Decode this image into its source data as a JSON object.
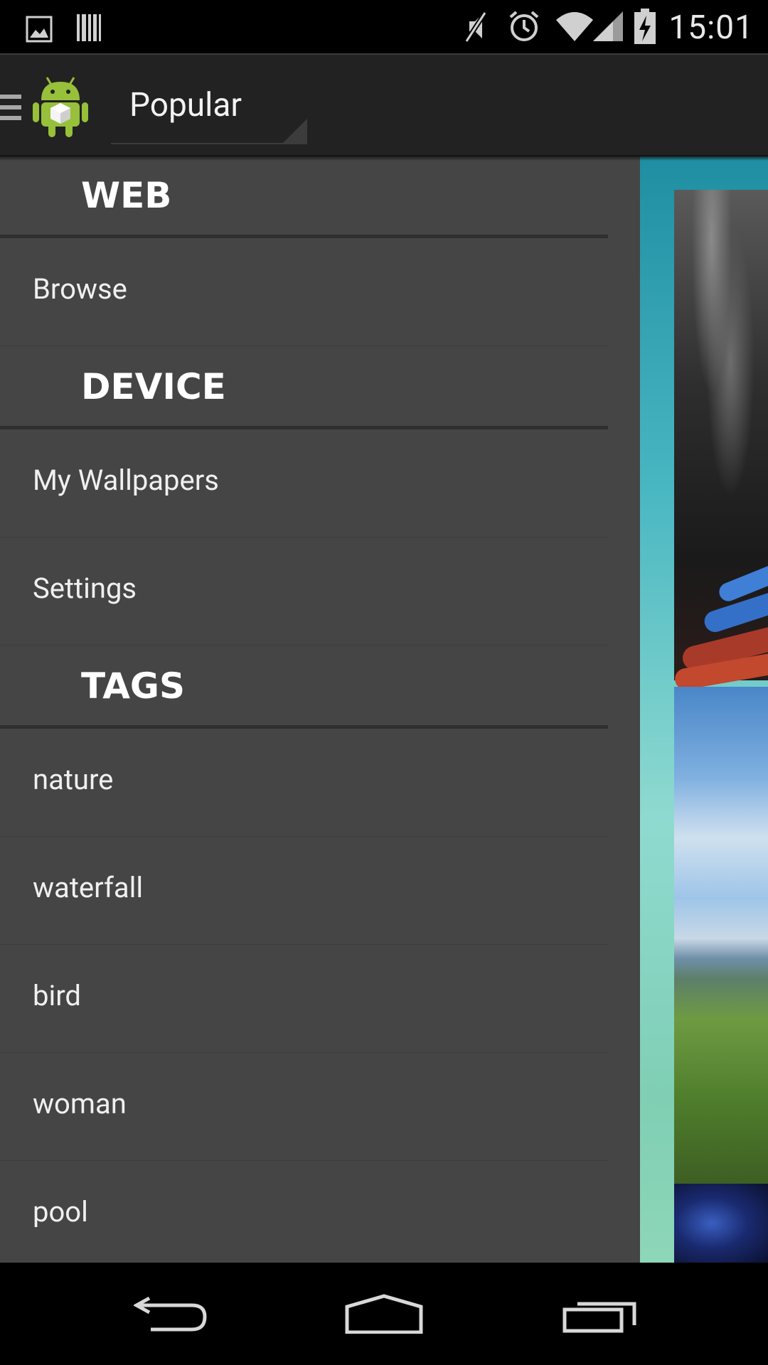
{
  "status_bar": {
    "time": "15:01",
    "icons": [
      "image-notification-icon",
      "barcode-notification-icon",
      "muted-icon",
      "alarm-icon",
      "wifi-icon",
      "signal-icon",
      "battery-charging-icon"
    ]
  },
  "action_bar": {
    "title": "Popular",
    "icons": [
      "drawer-indicator-icon",
      "android-logo-icon"
    ]
  },
  "drawer": {
    "sections": [
      {
        "header": "WEB",
        "items": [
          "Browse"
        ]
      },
      {
        "header": "DEVICE",
        "items": [
          "My Wallpapers",
          "Settings"
        ]
      },
      {
        "header": "TAGS",
        "items": [
          "nature",
          "waterfall",
          "bird",
          "woman",
          "pool"
        ]
      }
    ]
  },
  "nav_bar": {
    "icons": [
      "back-icon",
      "home-icon",
      "recents-icon"
    ]
  },
  "colors": {
    "drawer_background": "#454545",
    "action_bar_background": "#222222",
    "content_accent": "#49b7c2"
  }
}
